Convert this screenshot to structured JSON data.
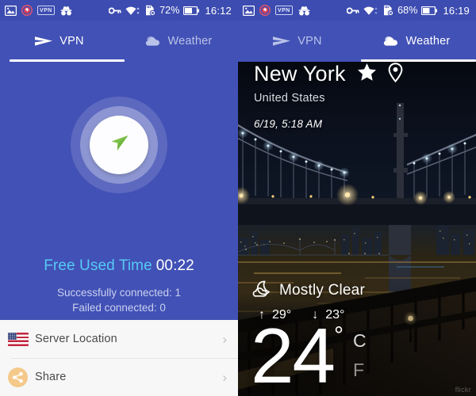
{
  "left": {
    "statusbar": {
      "icons": [
        "photo-icon",
        "record-icon",
        "vpn-badge-icon",
        "incognito-icon"
      ],
      "vpn_badge": "VPN",
      "right_icons": [
        "key-icon",
        "wifi-icon",
        "sdcard-error-icon"
      ],
      "battery_percent": "72%",
      "time": "16:12"
    },
    "tabs": [
      {
        "label": "VPN",
        "icon": "send-icon",
        "active": true
      },
      {
        "label": "Weather",
        "icon": "cloud-icon",
        "active": false
      }
    ],
    "dial": {
      "icon": "send-icon",
      "accent": "#7cc14a"
    },
    "free_time_label": "Free Used Time",
    "free_time_value": "00:22",
    "stat_success": "Successfully connected: 1",
    "stat_failed": "Failed connected: 0",
    "menu": [
      {
        "label": "Server Location",
        "icon": "us-flag-icon",
        "chevron": "›"
      },
      {
        "label": "Share",
        "icon": "share-icon",
        "chevron": "›"
      }
    ],
    "colors": {
      "bg": "#4251b5",
      "accent_cyan": "#56c9f5",
      "statusbar": "#3d4cb0"
    }
  },
  "right": {
    "statusbar": {
      "vpn_badge": "VPN",
      "battery_percent": "68%",
      "time": "16:19"
    },
    "tabs": [
      {
        "label": "VPN",
        "icon": "send-icon",
        "active": false
      },
      {
        "label": "Weather",
        "icon": "cloud-icon",
        "active": true
      }
    ],
    "city": "New York",
    "favorite_icon": "star-icon",
    "location_icon": "map-pin-icon",
    "country": "United States",
    "datetime": "6/19, 5:18 AM",
    "condition": "Mostly Clear",
    "condition_icon": "moon-cloud-icon",
    "high_arrow": "↑",
    "high": "29°",
    "low_arrow": "↓",
    "low": "23°",
    "temperature": "24",
    "degree": "°",
    "unit_celsius": "C",
    "unit_fahrenheit": "F",
    "watermark": "flickr"
  }
}
